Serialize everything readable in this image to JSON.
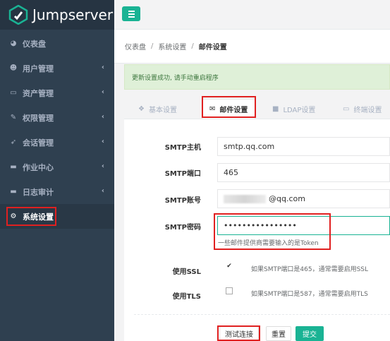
{
  "app": {
    "name": "Jumpserver"
  },
  "sidebar": {
    "items": [
      {
        "label": "仪表盘",
        "icon": "dashboard-icon",
        "has_children": false
      },
      {
        "label": "用户管理",
        "icon": "users-icon",
        "has_children": true
      },
      {
        "label": "资产管理",
        "icon": "inbox-icon",
        "has_children": true
      },
      {
        "label": "权限管理",
        "icon": "edit-icon",
        "has_children": true
      },
      {
        "label": "会话管理",
        "icon": "rocket-icon",
        "has_children": true
      },
      {
        "label": "作业中心",
        "icon": "coffee-icon",
        "has_children": true
      },
      {
        "label": "日志审计",
        "icon": "coffee-icon",
        "has_children": true
      },
      {
        "label": "系统设置",
        "icon": "gears-icon",
        "has_children": false,
        "active": true
      }
    ]
  },
  "breadcrumb": {
    "items": [
      "仪表盘",
      "系统设置"
    ],
    "current": "邮件设置"
  },
  "alert": {
    "message": "更新设置成功, 请手动重启程序"
  },
  "tabs": [
    {
      "label": "基本设置",
      "icon": "cubes-icon"
    },
    {
      "label": "邮件设置",
      "icon": "envelope-icon",
      "active": true
    },
    {
      "label": "LDAP设置",
      "icon": "square-icon"
    },
    {
      "label": "终端设置",
      "icon": "hdd-icon"
    }
  ],
  "form": {
    "smtp_host": {
      "label": "SMTP主机",
      "value": "smtp.qq.com"
    },
    "smtp_port": {
      "label": "SMTP端口",
      "value": "465"
    },
    "smtp_user": {
      "label": "SMTP账号",
      "value": "@qq.com"
    },
    "smtp_password": {
      "label": "SMTP密码",
      "value": "••••••••••••••••",
      "help": "一些邮件提供商需要输入的是Token"
    },
    "use_ssl": {
      "label": "使用SSL",
      "checked": true,
      "help": "如果SMTP端口是465，通常需要启用SSL"
    },
    "use_tls": {
      "label": "使用TLS",
      "checked": false,
      "help": "如果SMTP端口是587，通常需要启用TLS"
    }
  },
  "buttons": {
    "test": "测试连接",
    "reset": "重置",
    "submit": "提交"
  },
  "colors": {
    "sidebar_bg": "#2f4050",
    "accent": "#1ab394",
    "highlight": "#e02020",
    "alert_bg": "#dff0d8"
  }
}
